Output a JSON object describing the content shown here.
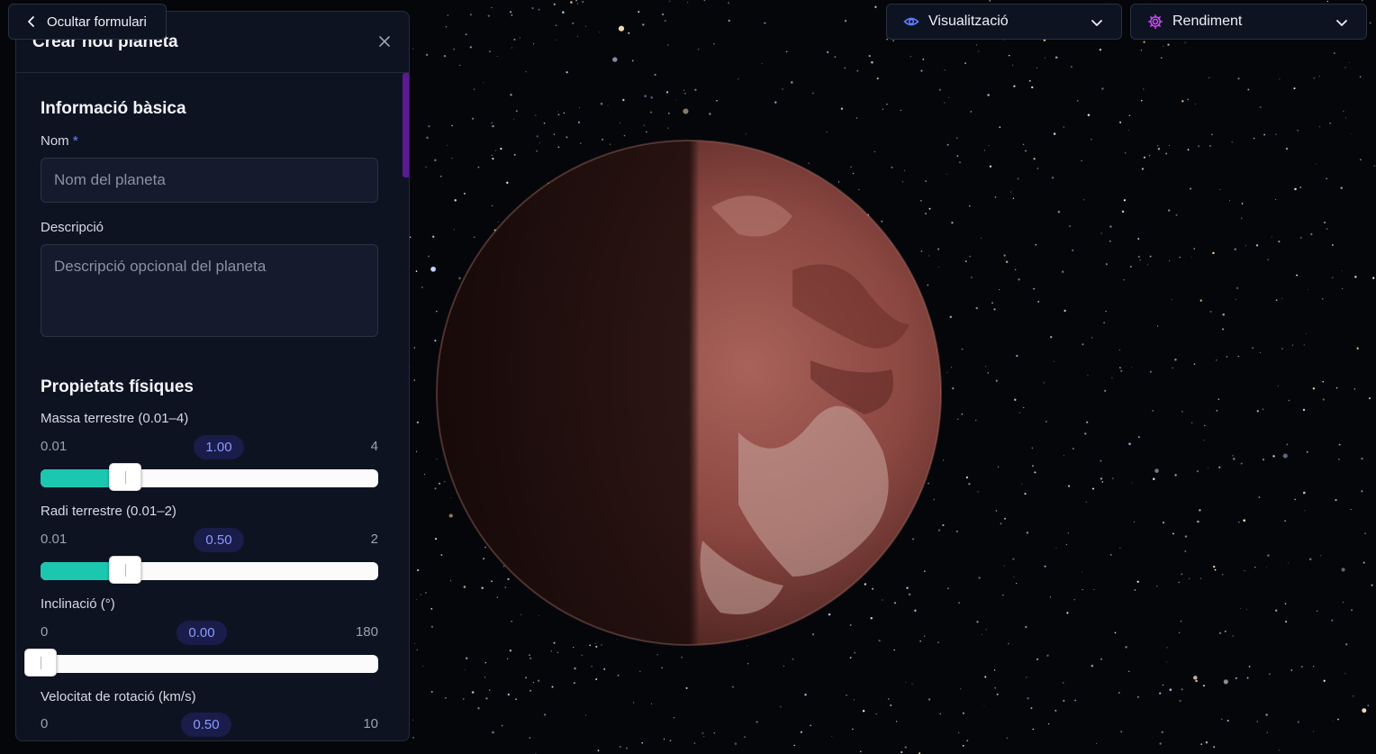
{
  "toggle": {
    "label": "Ocultar formulari"
  },
  "panel": {
    "title": "Crear nou planeta",
    "basic": {
      "title": "Informació bàsica",
      "name_label": "Nom",
      "name_required": "*",
      "name_placeholder": "Nom del planeta",
      "desc_label": "Descripció",
      "desc_placeholder": "Descripció opcional del planeta"
    },
    "physical": {
      "title": "Propietats físiques",
      "sliders": [
        {
          "label": "Massa terrestre (0.01–4)",
          "min": "0.01",
          "max": "4",
          "value": "1.00",
          "fraction": 0.25
        },
        {
          "label": "Radi terrestre (0.01–2)",
          "min": "0.01",
          "max": "2",
          "value": "0.50",
          "fraction": 0.25
        },
        {
          "label": "Inclinació (°)",
          "min": "0",
          "max": "180",
          "value": "0.00",
          "fraction": 0.0
        },
        {
          "label": "Velocitat de rotació (km/s)",
          "min": "0",
          "max": "10",
          "value": "0.50",
          "fraction": 0.05
        }
      ]
    }
  },
  "header": {
    "view_dropdown": {
      "label": "Visualització",
      "icon": "eye-icon"
    },
    "perf_dropdown": {
      "label": "Rendiment",
      "icon": "gear-icon"
    }
  },
  "colors": {
    "accent_fill": "#1cc7b0",
    "pill_bg": "#1a1c4a",
    "pill_text": "#8a9cff",
    "perf_icon": "#d047ff",
    "view_icon": "#5b7dff",
    "planet": "#a5554f"
  }
}
